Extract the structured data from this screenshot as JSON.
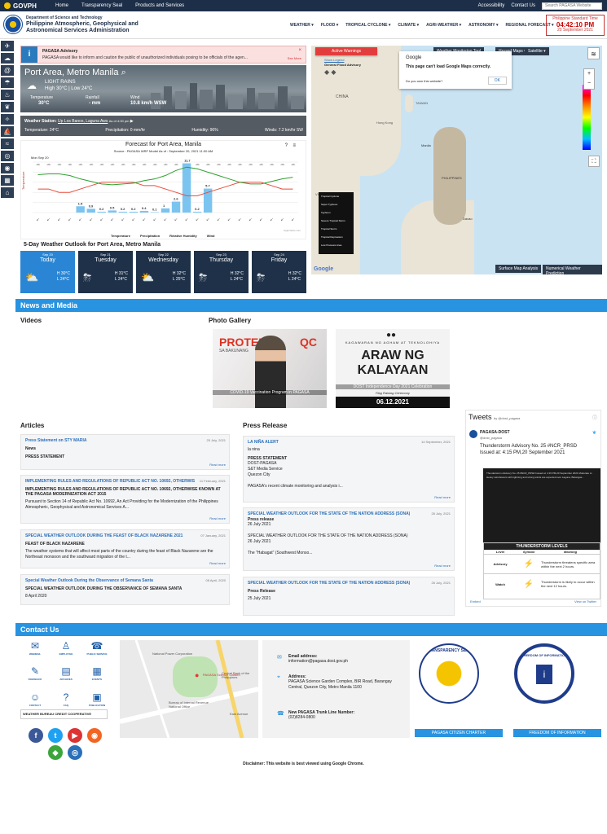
{
  "govbar": {
    "logo": "GOVPH",
    "nav": [
      "Home",
      "Transparency Seal",
      "Products and Services"
    ],
    "accessibility": "Accessibility",
    "contact": "Contact Us",
    "search_placeholder": "Search PAGASA Website"
  },
  "header": {
    "dept": "Department of Science and Technology",
    "agency_line1": "Philippine Atmospheric, Geophysical and",
    "agency_line2": "Astronomical Services Administration",
    "nav": [
      "WEATHER ▾",
      "FLOOD ▾",
      "TROPICAL CYCLONE ▾",
      "CLIMATE ▾",
      "AGRI-WEATHER ▾",
      "ASTRONOMY ▾",
      "REGIONAL FORECAST ▾"
    ],
    "pst_label": "Philippine Standard Time",
    "pst_time": "04:42:10 PM",
    "pst_date": "20 September 2021"
  },
  "advisory": {
    "title": "PAGASA Advisory",
    "text": "PAGASA would like to inform and caution the public of unauthorized individuals posing to be officials of the agen...",
    "more": "See More",
    "close": "×"
  },
  "weather": {
    "city": "Port Area, Metro Manila",
    "condition": "LIGHT RAINS",
    "hilo": "High 30°C | Low 24°C",
    "labels": [
      "Temperature",
      "Rainfall",
      "Wind"
    ],
    "values": [
      "30°C",
      "- mm",
      "10.8 km/h WSW"
    ]
  },
  "station": {
    "prefix": "Weather Station:",
    "name": "Up Los Banos, Laguna Aws",
    "asof": "As of 4:00 pm",
    "temperature": "Temperature: 24°C",
    "precipitation": "Precipitation: 0 mm/hr",
    "humidity": "Humidity: 96%",
    "winds": "Winds: 7.2 km/hr SW"
  },
  "forecast": {
    "title": "Forecast for Port Area, Manila",
    "subtitle": "Source : PAGASA WRF Model    As of : September 20, 2021 11:00 AM",
    "day_label": "Mon Sep 20",
    "legend": [
      "Temperature",
      "Precipitation",
      "Relative Humidity",
      "Wind"
    ],
    "credit": "Highcharts.com"
  },
  "chart_data": {
    "type": "bar",
    "title": "Forecast for Port Area, Manila",
    "xlabel": "",
    "ylabel": "Temperature",
    "series": [
      {
        "name": "Precipitation",
        "values": [
          0,
          0,
          0,
          0,
          1.5,
          0.9,
          0.2,
          0.5,
          0.2,
          0.2,
          0.4,
          0.1,
          1,
          2.6,
          11.7,
          0.2,
          5.7,
          0,
          0,
          0,
          0,
          0,
          0,
          0,
          0
        ]
      },
      {
        "name": "Temperature",
        "values": [
          27,
          27,
          26,
          26,
          27,
          28,
          29,
          29,
          29,
          29,
          28,
          28,
          27,
          26,
          25,
          25,
          26,
          27,
          28,
          29,
          29,
          29,
          28,
          27,
          27
        ]
      },
      {
        "name": "Relative Humidity",
        "values": [
          85,
          86,
          86,
          84,
          80,
          77,
          74,
          73,
          74,
          75,
          78,
          80,
          84,
          90,
          94,
          92,
          88,
          84,
          80,
          76,
          74,
          74,
          77,
          80,
          82
        ]
      }
    ],
    "bar_labels": [
      "1.5",
      "0.9",
      "0.2",
      "0.5",
      "0.2",
      "0.2",
      "0.4",
      "0.1",
      "1",
      "2.6",
      "11.7",
      "0.2",
      "5.7"
    ]
  },
  "outlook": {
    "title": "5-Day Weather Outlook for Port Area, Metro Manila",
    "days": [
      {
        "date": "Sep 20",
        "name": "Today",
        "hi": "H 30°C",
        "lo": "L 24°C"
      },
      {
        "date": "Sep 21",
        "name": "Tuesday",
        "hi": "H 31°C",
        "lo": "L 24°C"
      },
      {
        "date": "Sep 22",
        "name": "Wednesday",
        "hi": "H 32°C",
        "lo": "L 25°C"
      },
      {
        "date": "Sep 23",
        "name": "Thursday",
        "hi": "H 32°C",
        "lo": "L 24°C"
      },
      {
        "date": "Sep 24",
        "name": "Friday",
        "hi": "H 32°C",
        "lo": "L 24°C"
      }
    ]
  },
  "map": {
    "active_warnings": "Active Warnings",
    "show_legend": "Show Legend",
    "flood_advisory": "General Flood Advisory",
    "tool": "Weather Monitoring Tool",
    "hazard": "Hazard Maps ▾",
    "satellite": "Satellite ▾",
    "popup_brand": "Google",
    "popup_msg": "This page can't load Google Maps correctly.",
    "popup_q": "Do you own this website?",
    "popup_ok": "OK",
    "google": "Google",
    "surface": "Surface Map Analysis",
    "nwp": "Numerical Weather Prediction",
    "tc_legend": [
      "Tropical Cyclone",
      "Super Typhoon",
      "Typhoon",
      "Severe Tropical Storm",
      "Tropical Storm",
      "Tropical Depression",
      "Low Pressure Area"
    ],
    "labels": [
      "CHINA",
      "TAIWAN",
      "Hong Kong",
      "PHILIPPINES",
      "VIETNAM",
      "Manila",
      "Davao"
    ]
  },
  "news": {
    "bar": "News and Media",
    "videos": "Videos",
    "photo_gallery": "Photo Gallery",
    "photo1_caption": "COVID-19 Vaccination Program in PAGASA",
    "photo1_a": "PROTEK",
    "photo1_b": "QC",
    "photo1_c": "SA BAKUNANG",
    "photo2_k1": "KAGAWARAN NG AGHAM AT TEKNOLOHIYA",
    "photo2_k2": "ARAW NG",
    "photo2_k3": "KALAYAAN",
    "photo2_caption": "DOST Independence Day 2021 Celebration",
    "photo2_sub": "Flag Raising Ceremony",
    "photo2_date": "06.12.2021"
  },
  "articles": {
    "title": "Articles",
    "read_more": "Read more",
    "items": [
      {
        "title": "Press Statement on STY MARIA",
        "date": "25 July, 2021",
        "cat": "News",
        "sub": "PRESS STATEMENT",
        "body": ""
      },
      {
        "title": "IMPLEMENTING RULES AND REGULATIONS OF REPUBLIC ACT NO. 10692, OTHERWIS",
        "date": "11 February, 2021",
        "cat": "",
        "sub": "IMPLEMENTING RULES AND REGULATIONS OF REPUBLIC ACT NO. 10692, OTHERWISE KNOWN AT THE PAGASA MODERNIZATION ACT 2015",
        "body": "Pursuant to Section 14 of Republic Act No. 10692, An Act Providing for the Modernization of the Philippines Atmospheric, Geophysical and Astronomical Services A..."
      },
      {
        "title": "SPECIAL WEATHER OUTLOOK DURING THE FEAST OF BLACK NAZARENE 2021",
        "date": "07 January, 2021",
        "cat": "",
        "sub": "FEAST OF BLACK NAZARENE",
        "body": "The weather systems that will affect most parts of the country during the feast of Black Nazarene are the Northeast monsoon and the southward migration of the t..."
      },
      {
        "title": "Special Weather Outlook During the Observance of Semana Santa",
        "date": "08 April, 2020",
        "cat": "",
        "sub": "SPECIAL WEATHER OUTLOOK DURING THE OBSERVANCE OF SEMANA SANTA",
        "body": "8 April 2020"
      }
    ]
  },
  "press": {
    "title": "Press Release",
    "read_more": "Read more",
    "items": [
      {
        "title": "LA NIÑA ALERT",
        "date": "14 September, 2021",
        "cat": "la nina",
        "sub": "PRESS STATEMENT",
        "body": "DOST-PAGASA\nS&T Media Service\nQuezon City\n\nPAGASA's recent climate monitoring and analysis i..."
      },
      {
        "title": "SPECIAL WEATHER OUTLOOK FOR THE STATE OF THE NATION ADDRESS (SONA)",
        "date": "26 July, 2021",
        "cat": "Press release",
        "sub": "",
        "body": "26 July 2021\n\nSPECIAL WEATHER OUTLOOK FOR THE STATE OF THE NATION ADDRESS (SONA)\n26 July 2021\n\nThe \"Habagat\" (Southwest Monso..."
      },
      {
        "title": "SPECIAL WEATHER OUTLOOK FOR THE STATE OF THE NATION ADDRESS (SONA)",
        "date": "26 July, 2021",
        "cat": "Press Release",
        "sub": "",
        "body": "25 July 2021"
      }
    ]
  },
  "tweets": {
    "title": "Tweets",
    "by": "by @dost_pagasa",
    "account": "PAGASA-DOST",
    "handle": "@dost_pagasa",
    "content": "Thunderstorm Advisory No. 25 #NCR_PRSD",
    "issued": "Issued at: 4:15 PM,20 September 2021",
    "img_text": "Thunderstorm Advisory No. 25 #NCR_PRSD Issued at: 4:15 PM,20 September 2021 Moderate to Heavy rainshowers with lightning and strong winds are expected over Laguna, Batangas...",
    "levels_title": "THUNDERSTORM LEVELS",
    "levels_head": [
      "Level",
      "Symbol",
      "Meaning"
    ],
    "levels": [
      {
        "level": "Advisory",
        "meaning": "Thunderstorm threatens specific area within the next 2 hours."
      },
      {
        "level": "Watch",
        "meaning": "Thunderstorm is likely to occur within the next 12 hours."
      }
    ],
    "embed": "Embed",
    "view": "View on Twitter"
  },
  "contact": {
    "bar": "Contact Us",
    "icons": [
      "WEBMAIL",
      "EMPLOYEE",
      "PUBLIC SERVICE",
      "FEEDBACK",
      "ARCHIVES",
      "EVENTS",
      "CONTACT",
      "FAQ",
      "PUBLICATION"
    ],
    "coop": "WEATHER BUREAU CREDIT COOPERATIVE",
    "email_label": "Email address:",
    "email": "information@pagasa.dost.gov.ph",
    "address_label": "Address:",
    "address": "PAGASA Science Garden Complex, BIR Road, Barangay Central, Quezon City, Metro Manila 1100",
    "trunk_label": "New PAGASA Trunk Line Number:",
    "trunk": "(02)8284-0800",
    "map_pin": "PAGASA Science Garden",
    "map_labels": [
      "National Power Corporation",
      "Central Bank of the Philippines",
      "Bureau of Internal Revenue National Office",
      "East Avenue"
    ],
    "charter_btn": "PAGASA CITIZEN CHARTER",
    "foi_btn": "FREEDOM OF INFORMATION",
    "seal1": "TRANSPARENCY SEAL",
    "seal2": "FREEDOM OF INFORMATION"
  },
  "disclaimer": "Disclaimer: This website is best viewed using Google Chrome.",
  "colors": {
    "accent": "#2893e0",
    "navy": "#1d2e48",
    "alert": "#c33333"
  }
}
